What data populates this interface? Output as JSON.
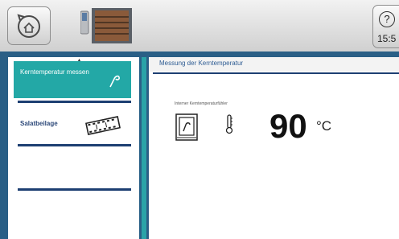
{
  "toolbar": {
    "home_icon": "undo-home-icon",
    "oven_icon": "combi-oven-icon",
    "help_symbol": "?",
    "time": "15:5"
  },
  "sidebar": {
    "scroll_indicator": "▲",
    "items": [
      {
        "label": "Kerntemperatur messen",
        "icon": "core-probe-icon",
        "active": true
      },
      {
        "label": "Salatbeilage",
        "icon": "film-strip-icon",
        "active": false
      },
      {
        "label": "",
        "icon": "",
        "active": false
      }
    ]
  },
  "content": {
    "title": "Messung der Kerntemperatur",
    "sensor_label": "Interner Kerntemperaturfühler",
    "temperature": "90",
    "unit": "°C"
  },
  "colors": {
    "frame": "#2a5f86",
    "active_item": "#23a8a6",
    "rule": "#1d3f72",
    "title_text": "#2e5c93"
  }
}
